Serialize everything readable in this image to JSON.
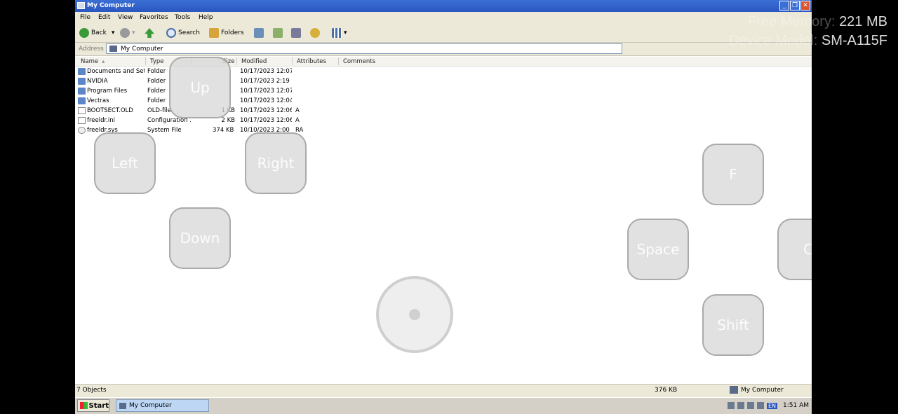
{
  "window": {
    "title": "My Computer"
  },
  "menu": [
    "File",
    "Edit",
    "View",
    "Favorites",
    "Tools",
    "Help"
  ],
  "toolbar": {
    "back": "Back",
    "search": "Search",
    "folders": "Folders"
  },
  "address": {
    "label": "Address",
    "value": "My Computer"
  },
  "columns": {
    "name": "Name",
    "type": "Type",
    "size": "Size",
    "modified": "Modified",
    "attributes": "Attributes",
    "comments": "Comments"
  },
  "files": [
    {
      "name": "Documents and Set...",
      "type": "Folder",
      "size": "",
      "modified": "10/17/2023 12:07...",
      "attr": "",
      "icon": "folder"
    },
    {
      "name": "NVIDIA",
      "type": "Folder",
      "size": "",
      "modified": "10/17/2023 2:19 ...",
      "attr": "",
      "icon": "folder"
    },
    {
      "name": "Program Files",
      "type": "Folder",
      "size": "",
      "modified": "10/17/2023 12:07...",
      "attr": "",
      "icon": "folder"
    },
    {
      "name": "Vectras",
      "type": "Folder",
      "size": "",
      "modified": "10/17/2023 12:04...",
      "attr": "",
      "icon": "folder"
    },
    {
      "name": "BOOTSECT.OLD",
      "type": "OLD-file",
      "size": "1 KB",
      "modified": "10/17/2023 12:06...",
      "attr": "A",
      "icon": "doc"
    },
    {
      "name": "freeldr.ini",
      "type": "Configuration ...",
      "size": "2 KB",
      "modified": "10/17/2023 12:06...",
      "attr": "A",
      "icon": "cfg"
    },
    {
      "name": "freeldr.sys",
      "type": "System File",
      "size": "374 KB",
      "modified": "10/10/2023 2:00 ...",
      "attr": "RA",
      "icon": "sys"
    }
  ],
  "controls": {
    "up": "Up",
    "left": "Left",
    "right": "Right",
    "down": "Down",
    "f": "F",
    "space": "Space",
    "shift": "Shift",
    "partial": "C"
  },
  "status": {
    "count": "7 Objects",
    "size": "376 KB",
    "location": "My Computer"
  },
  "taskbar": {
    "start": "Start",
    "task": "My Computer",
    "lang": "EN",
    "time": "1:51 AM"
  },
  "overlay": {
    "memory_label": "Free Memory:",
    "memory": "221 MB",
    "device_label": "Device Model:",
    "device": "SM-A115F"
  }
}
